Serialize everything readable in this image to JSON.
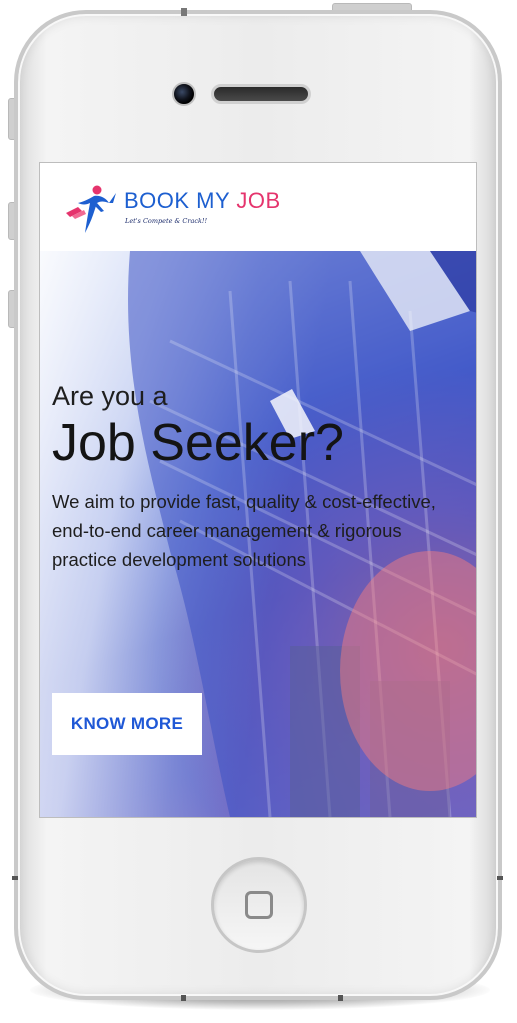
{
  "brand": {
    "word_a": "BOOK MY ",
    "word_b": "JOB",
    "tagline": "Let's Compete & Crack!!",
    "colors": {
      "blue": "#1d5fd0",
      "pink": "#e5346d"
    }
  },
  "hero": {
    "kicker": "Are you a",
    "title": "Job Seeker?",
    "description": "We aim to provide fast, quality & cost-effective, end-to-end career management & rigorous practice development solutions",
    "cta_label": "KNOW MORE",
    "cta_color": "#1f58d6"
  },
  "icons": {
    "logo": "runner-arrow-logo-icon",
    "home": "home-square-icon"
  }
}
